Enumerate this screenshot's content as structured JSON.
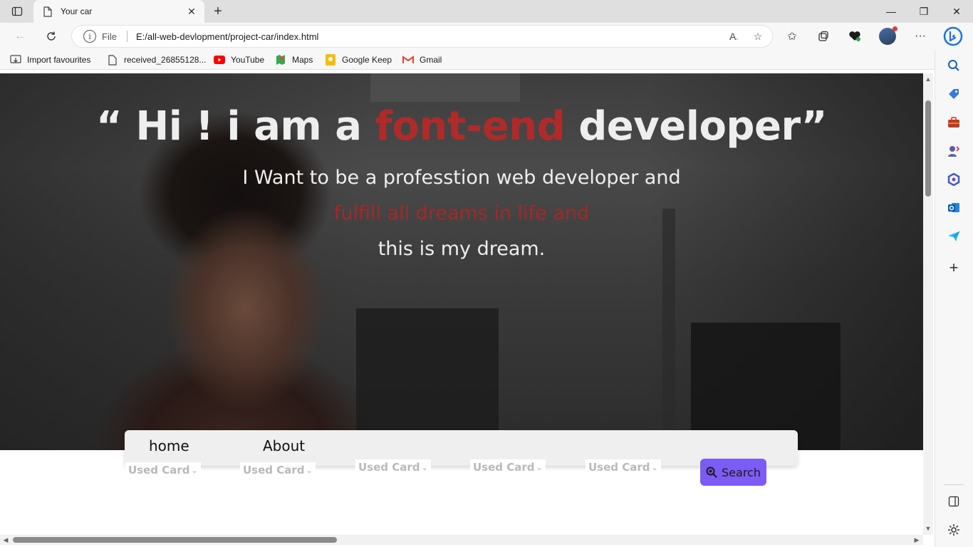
{
  "browser": {
    "tab": {
      "title": "Your car"
    },
    "address_bar": {
      "scheme_label": "File",
      "url": "E:/all-web-devlopment/project-car/index.html"
    },
    "favourites": [
      {
        "label": "Import favourites",
        "icon": "import-icon"
      },
      {
        "label": "received_26855128...",
        "icon": "file-icon"
      },
      {
        "label": "YouTube",
        "icon": "youtube-icon"
      },
      {
        "label": "Maps",
        "icon": "maps-icon"
      },
      {
        "label": "Google Keep",
        "icon": "keep-icon"
      },
      {
        "label": "Gmail",
        "icon": "gmail-icon"
      }
    ],
    "colors": {
      "youtube": "#ff0000",
      "keep": "#fbbc04",
      "bing": "#1a73e8"
    }
  },
  "page": {
    "hero": {
      "headline_before": "“ Hi ! i am a ",
      "headline_accent": "font-end",
      "headline_after": " developer”",
      "line1": "I Want to be a professtion web developer and",
      "line2": "fulfill all dreams in life and",
      "line3": "this is my dream.",
      "accent_color": "#b02a2a"
    },
    "nav": {
      "home": "home",
      "about": "About"
    },
    "filters": [
      "Used Card",
      "Used Card",
      "Used Card",
      "Used Card",
      "Used Card"
    ],
    "search_label": "Search",
    "search_color": "#7b5cf5"
  }
}
